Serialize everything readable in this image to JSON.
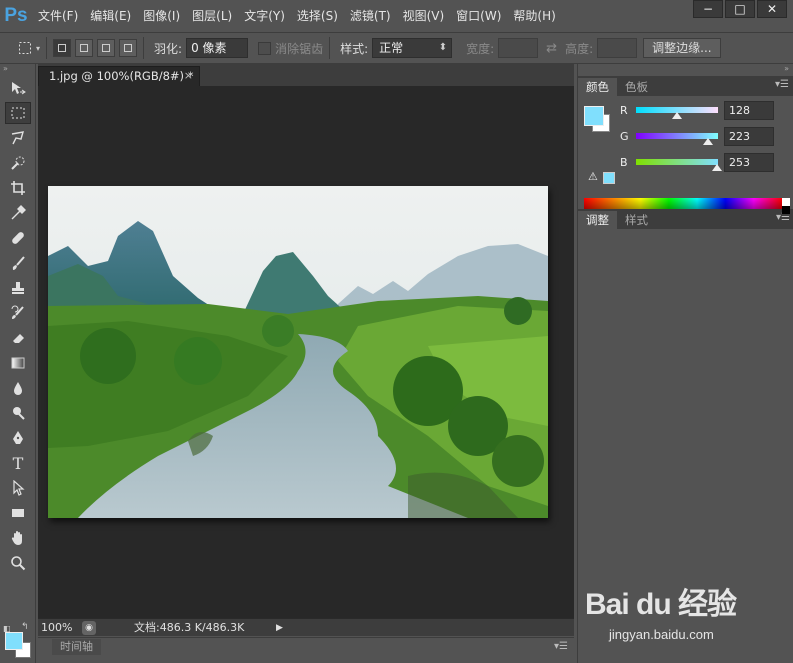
{
  "app": {
    "logo": "Ps"
  },
  "menu": [
    "文件(F)",
    "编辑(E)",
    "图像(I)",
    "图层(L)",
    "文字(Y)",
    "选择(S)",
    "滤镜(T)",
    "视图(V)",
    "窗口(W)",
    "帮助(H)"
  ],
  "window_controls": {
    "minimize": "−",
    "maximize": "□",
    "close": "✕"
  },
  "options": {
    "feather_label": "羽化:",
    "feather_value": "0 像素",
    "antialias_label": "消除锯齿",
    "style_label": "样式:",
    "style_value": "正常",
    "width_label": "宽度:",
    "height_label": "高度:",
    "refine_button": "调整边缘..."
  },
  "document": {
    "tab_title": "1.jpg @ 100%(RGB/8#) *",
    "tab_close": "×",
    "zoom": "100%",
    "doc_info": "文档:486.3 K/486.3K",
    "status_arrow": "▶"
  },
  "timeline": {
    "tab": "时间轴"
  },
  "color_panel": {
    "tabs": [
      "颜色",
      "色板"
    ],
    "foreground": "#80dffd",
    "background": "#ffffff",
    "channels": [
      {
        "label": "R",
        "value": "128",
        "fraction": 0.502
      },
      {
        "label": "G",
        "value": "223",
        "fraction": 0.875
      },
      {
        "label": "B",
        "value": "253",
        "fraction": 0.992
      }
    ]
  },
  "adjust_panel": {
    "tabs": [
      "调整",
      "样式"
    ]
  },
  "tools": [
    "move-tool",
    "marquee-tool",
    "lasso-tool",
    "quick-select-tool",
    "crop-tool",
    "eyedropper-tool",
    "healing-brush-tool",
    "brush-tool",
    "clone-stamp-tool",
    "history-brush-tool",
    "eraser-tool",
    "gradient-tool",
    "blur-tool",
    "dodge-tool",
    "pen-tool",
    "type-tool",
    "path-select-tool",
    "rectangle-tool",
    "hand-tool",
    "zoom-tool"
  ],
  "watermark": {
    "brand": "Bai du 经验",
    "url": "jingyan.baidu.com"
  }
}
